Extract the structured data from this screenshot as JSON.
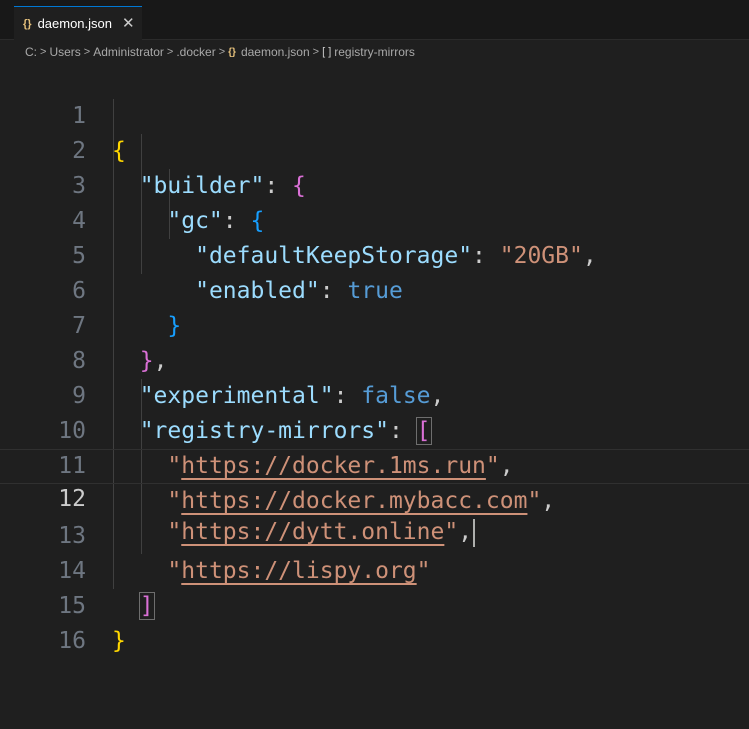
{
  "tab": {
    "icon_text": "{}",
    "filename": "daemon.json",
    "close_glyph": "✕"
  },
  "breadcrumb": {
    "items": [
      "C:",
      "Users",
      "Administrator",
      ".docker",
      "daemon.json",
      "registry-mirrors"
    ],
    "separator": ">",
    "file_icon_text": "{}",
    "array_icon_text": "[ ]"
  },
  "editor": {
    "current_line": 12,
    "line_numbers": [
      "1",
      "2",
      "3",
      "4",
      "5",
      "6",
      "7",
      "8",
      "9",
      "10",
      "11",
      "12",
      "13",
      "14",
      "15",
      "16"
    ],
    "tokens": {
      "open_root": "{",
      "builder_key": "\"builder\"",
      "colon": ":",
      "open_builder": "{",
      "gc_key": "\"gc\"",
      "open_gc": "{",
      "dks_key": "\"defaultKeepStorage\"",
      "dks_value": "\"20GB\"",
      "comma": ",",
      "enabled_key": "\"enabled\"",
      "enabled_value": "true",
      "close_gc": "}",
      "close_builder": "}",
      "experimental_key": "\"experimental\"",
      "experimental_value": "false",
      "mirrors_key": "\"registry-mirrors\"",
      "open_array": "[",
      "quote": "\"",
      "mirror_1": "https://docker.1ms.run",
      "mirror_2": "https://docker.mybacc.com",
      "mirror_3": "https://dytt.online",
      "mirror_4": "https://lispy.org",
      "close_array": "]",
      "close_root": "}"
    }
  },
  "colors": {
    "background": "#1f1f1f",
    "key": "#9cdcfe",
    "string": "#ce9178",
    "keyword": "#569cd6",
    "bracket_level1": "#ffd700",
    "bracket_level2": "#da70d6",
    "bracket_level3": "#179fff",
    "tab_accent": "#0078d4"
  }
}
